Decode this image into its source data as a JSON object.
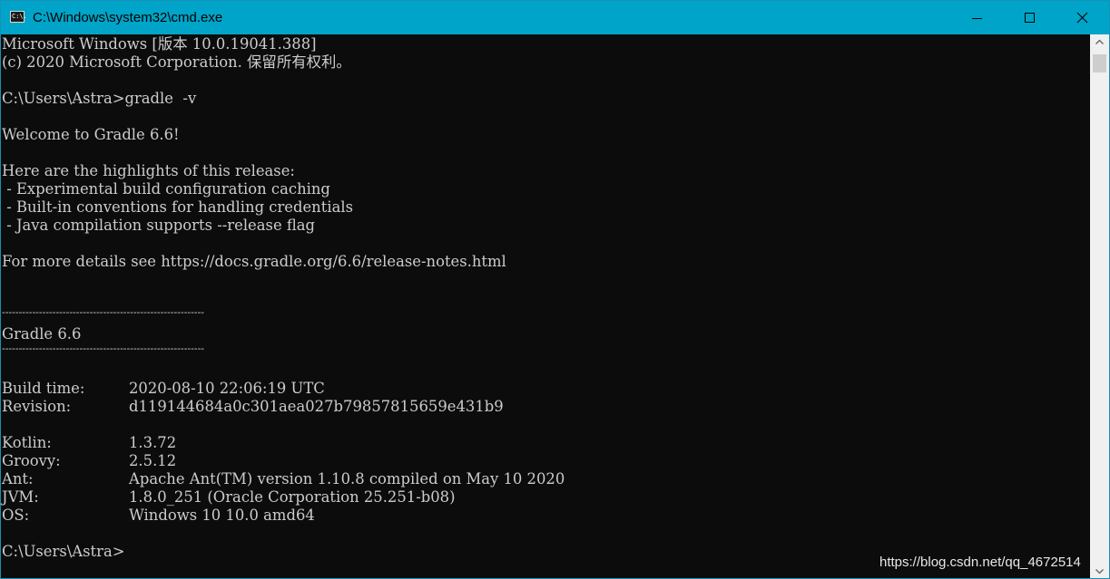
{
  "window": {
    "title": "C:\\Windows\\system32\\cmd.exe",
    "icon": "cmd-app-icon",
    "icon_glyph": "C:\\."
  },
  "controls": {
    "minimize_icon": "minimize-icon",
    "maximize_icon": "maximize-icon",
    "close_icon": "close-icon"
  },
  "console": {
    "header_line1": "Microsoft Windows [版本 10.0.19041.388]",
    "header_line2": "(c) 2020 Microsoft Corporation. 保留所有权利。",
    "command_line": "C:\\Users\\Astra>gradle  -v",
    "welcome": "Welcome to Gradle 6.6!",
    "highlights_title": "Here are the highlights of this release:",
    "highlights": [
      " - Experimental build configuration caching",
      " - Built-in conventions for handling credentials",
      " - Java compilation supports --release flag"
    ],
    "details": "For more details see https://docs.gradle.org/6.6/release-notes.html",
    "rule_text": "------------------------------------------------------------",
    "version_heading": "Gradle 6.6",
    "build_info": [
      {
        "label": "Build time:",
        "value": "2020-08-10 22:06:19 UTC"
      },
      {
        "label": "Revision:",
        "value": "d119144684a0c301aea027b79857815659e431b9"
      }
    ],
    "env_info": [
      {
        "label": "Kotlin:",
        "value": "1.3.72"
      },
      {
        "label": "Groovy:",
        "value": "2.5.12"
      },
      {
        "label": "Ant:",
        "value": "Apache Ant(TM) version 1.10.8 compiled on May 10 2020"
      },
      {
        "label": "JVM:",
        "value": "1.8.0_251 (Oracle Corporation 25.251-b08)"
      },
      {
        "label": "OS:",
        "value": "Windows 10 10.0 amd64"
      }
    ],
    "final_prompt": "C:\\Users\\Astra>"
  },
  "watermark": "https://blog.csdn.net/qq_4672514",
  "colors": {
    "titlebar": "#00a4c8",
    "console_bg": "#0c0c0c",
    "console_text": "#cccccc",
    "scrollbar_bg": "#f0f0f0",
    "scroll_thumb": "#cdcdcd"
  }
}
